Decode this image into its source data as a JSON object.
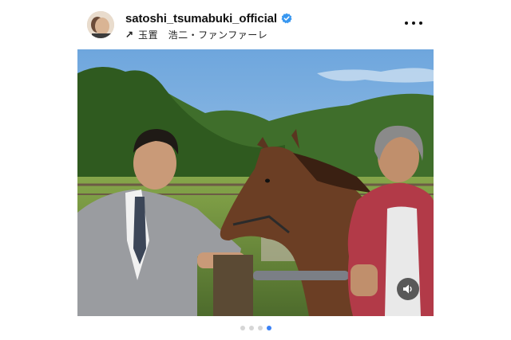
{
  "post": {
    "username": "satoshi_tsumabuki_official",
    "music": {
      "icon": "arrow-up-right-icon",
      "text": "玉置　浩二・ファンファーレ"
    },
    "verified_color": "#3897f0",
    "carousel": {
      "total": 4,
      "active_index": 4
    },
    "icons": {
      "more": "more-options-icon",
      "sound": "speaker-icon",
      "verified": "verified-badge-icon"
    }
  }
}
